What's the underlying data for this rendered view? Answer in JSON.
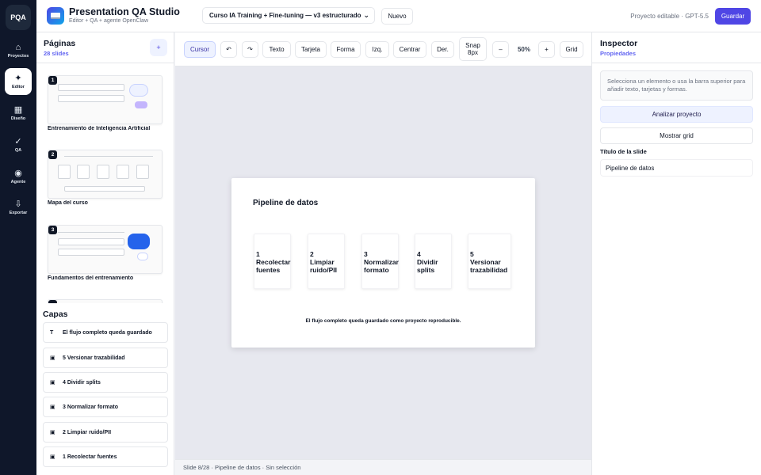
{
  "rail": {
    "logo": "PQA",
    "items": [
      {
        "icon": "⌂",
        "label": "Proyectos"
      },
      {
        "icon": "✦",
        "label": "Editor"
      },
      {
        "icon": "▦",
        "label": "Diseño"
      },
      {
        "icon": "✓",
        "label": "QA"
      },
      {
        "icon": "◉",
        "label": "Agente"
      },
      {
        "icon": "⇩",
        "label": "Exportar"
      }
    ]
  },
  "header": {
    "title": "Presentation QA Studio",
    "subtitle": "Editor + QA + agente OpenClaw",
    "project_select": "Curso IA Training + Fine-tuning — v3 estructurado",
    "new_label": "Nuevo",
    "status": "Proyecto editable · GPT-5.5",
    "save_label": "Guardar"
  },
  "pages": {
    "title": "Páginas",
    "count": "28 slides",
    "add_label": "+",
    "items": [
      {
        "num": "1",
        "label": "Entrenamiento de Inteligencia Artificial"
      },
      {
        "num": "2",
        "label": "Mapa del curso"
      },
      {
        "num": "3",
        "label": "Fundamentos del entrenamiento"
      }
    ]
  },
  "layers": {
    "title": "Capas",
    "items": [
      {
        "icon": "T",
        "label": "El flujo completo queda guardado"
      },
      {
        "icon": "▣",
        "label": "5 Versionar trazabilidad"
      },
      {
        "icon": "▣",
        "label": "4 Dividir splits"
      },
      {
        "icon": "▣",
        "label": "3 Normalizar formato"
      },
      {
        "icon": "▣",
        "label": "2 Limpiar ruido/PII"
      },
      {
        "icon": "▣",
        "label": "1 Recolectar fuentes"
      }
    ]
  },
  "toolbar": {
    "cursor": "Cursor",
    "undo": "↶",
    "redo": "↷",
    "text": "Texto",
    "card": "Tarjeta",
    "shape": "Forma",
    "left": "Izq.",
    "center": "Centrar",
    "right": "Der.",
    "snap_line1": "Snap",
    "snap_line2": "8px",
    "zoom_out": "–",
    "zoom": "50%",
    "zoom_in": "+",
    "grid": "Grid"
  },
  "slide": {
    "title": "Pipeline de datos",
    "steps": [
      "1\nRecolectar\nfuentes",
      "2\nLimpiar\nruido/PII",
      "3\nNormalizar\nformato",
      "4\nDividir\nsplits",
      "5\nVersionar\ntrazabilidad"
    ],
    "footer": "El flujo completo queda guardado como proyecto reproducible."
  },
  "status": "Slide 8/28 · Pipeline de datos · Sin selección",
  "inspector": {
    "title": "Inspector",
    "subtitle": "Propiedades",
    "hint": "Selecciona un elemento o usa la barra superior para añadir texto, tarjetas y formas.",
    "analyze_label": "Analizar proyecto",
    "grid_label": "Mostrar grid",
    "slide_title_label": "Título de la slide",
    "slide_title_value": "Pipeline de datos"
  },
  "colors": {
    "accent": "#4f46e5",
    "rail_bg": "#0f172a",
    "canvas_bg": "#e7e8ef"
  }
}
